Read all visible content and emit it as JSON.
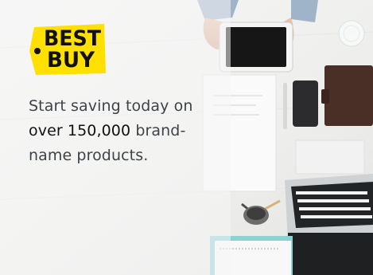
{
  "ad": {
    "brand_line1": "BEST",
    "brand_line2": "BUY",
    "promo_before": "Start saving today on ",
    "promo_highlight": "over 150,000",
    "promo_after": " brand-name products."
  },
  "colors": {
    "brand_yellow": "#ffe000",
    "brand_black": "#111111",
    "text": "#3f4248"
  },
  "icons": [
    "best-buy-tag-logo"
  ]
}
